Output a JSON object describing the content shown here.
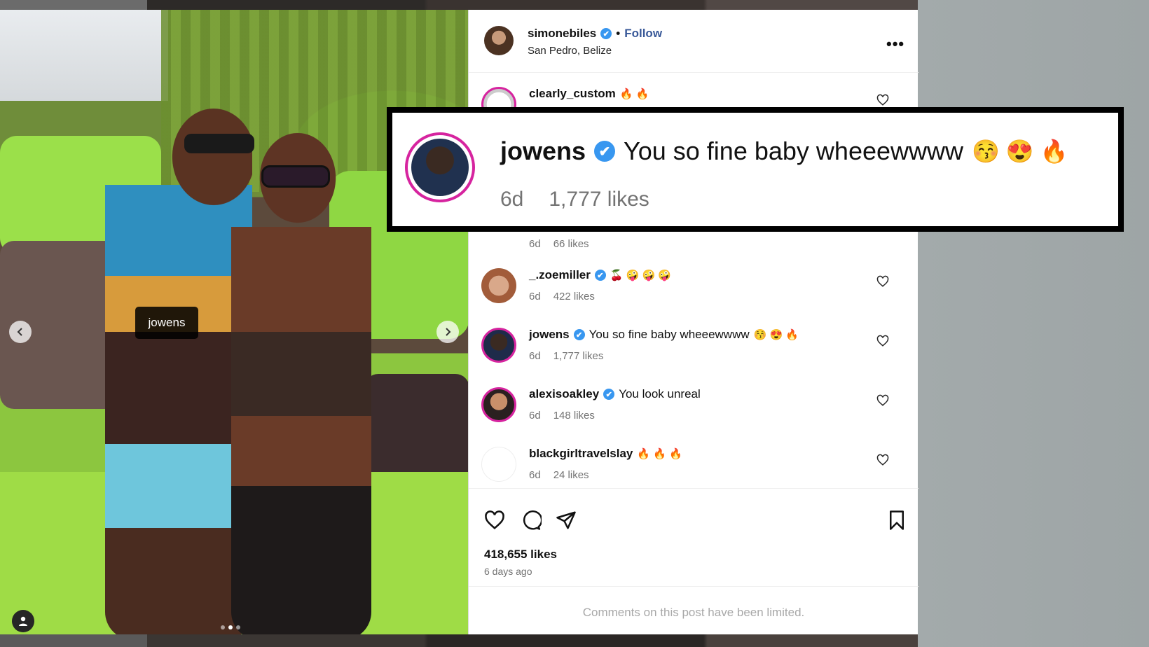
{
  "post": {
    "author": "simonebiles",
    "separator": "•",
    "follow_label": "Follow",
    "location": "San Pedro, Belize",
    "more_label": "•••",
    "photo_tag": "jowens",
    "likes": "418,655 likes",
    "posted": "6 days ago",
    "comments_limited": "Comments on this post have been limited."
  },
  "comments": [
    {
      "user": "clearly_custom",
      "text": "",
      "emoji": "🔥 🔥",
      "time": "",
      "likes": ""
    },
    {
      "user": "",
      "text": "",
      "emoji": "",
      "time": "6d",
      "likes": "66 likes"
    },
    {
      "user": "_.zoemiller",
      "text": "",
      "emoji": "🍒 🤪 🤪 🤪",
      "time": "6d",
      "likes": "422 likes"
    },
    {
      "user": "jowens",
      "text": "You so fine baby wheeewwww",
      "emoji": "😚 😍 🔥",
      "time": "6d",
      "likes": "1,777 likes"
    },
    {
      "user": "alexisoakley",
      "text": "You look unreal",
      "emoji": "",
      "time": "6d",
      "likes": "148 likes"
    },
    {
      "user": "blackgirltravelslay",
      "text": "",
      "emoji": "🔥 🔥 🔥",
      "time": "6d",
      "likes": "24 likes"
    }
  ],
  "callout": {
    "user": "jowens",
    "text": "You so fine baby wheeewwww",
    "emoji": "😚 😍 🔥",
    "time": "6d",
    "likes": "1,777 likes"
  },
  "icons": {
    "verified": "✔",
    "prev": "‹",
    "next": "›"
  },
  "colors": {
    "verified_blue": "#3897f0",
    "follow_blue": "#385898",
    "story_ring": "#d6249f"
  }
}
